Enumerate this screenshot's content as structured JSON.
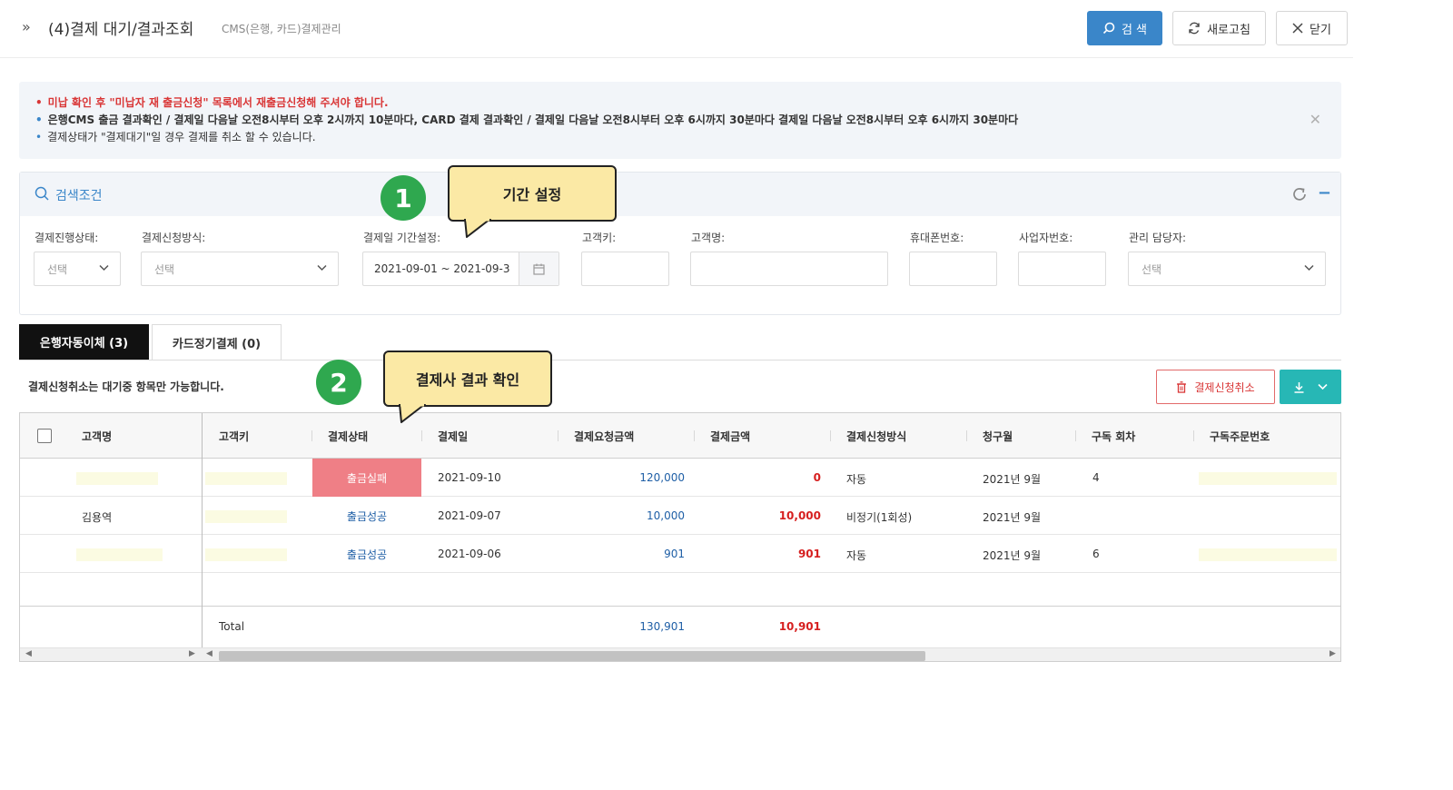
{
  "header": {
    "title": "(4)결제 대기/결과조회",
    "subtitle": "CMS(은행, 카드)결제관리",
    "search_label": "검 색",
    "refresh_label": "새로고침",
    "close_label": "닫기"
  },
  "notice": {
    "line1": "미납 확인 후 \"미납자 재 출금신청\" 목록에서 재출금신청해 주셔야 합니다.",
    "line2": "은행CMS 출금 결과확인 / 결제일 다음날 오전8시부터 오후 2시까지 10분마다, CARD 결제 결과확인 / 결제일 다음날 오전8시부터 오후 6시까지 30분마다 결제일 다음날 오전8시부터 오후 6시까지 30분마다",
    "line3": "결제상태가 \"결제대기\"일 경우 결제를 취소 할 수 있습니다."
  },
  "search_panel": {
    "title": "검색조건",
    "fields": {
      "status_label": "결제진행상태:",
      "status_value": "선택",
      "method_label": "결제신청방식:",
      "method_value": "선택",
      "period_label": "결제일 기간설정:",
      "period_value": "2021-09-01 ~ 2021-09-3",
      "customer_key_label": "고객키:",
      "customer_name_label": "고객명:",
      "phone_label": "휴대폰번호:",
      "biz_no_label": "사업자번호:",
      "manager_label": "관리 담당자:",
      "manager_value": "선택"
    }
  },
  "tabs": [
    {
      "label": "은행자동이체 (3)",
      "active": true
    },
    {
      "label": "카드정기결제 (0)",
      "active": false
    }
  ],
  "toolbar": {
    "note": "결제신청취소는 대기중 항목만 가능합니다.",
    "cancel_label": "결제신청취소"
  },
  "table": {
    "columns": [
      "고객명",
      "고객키",
      "결제상태",
      "결제일",
      "결제요청금액",
      "결제금액",
      "결제신청방식",
      "청구월",
      "구독 회차",
      "구독주문번호"
    ],
    "rows": [
      {
        "name": "",
        "key": "",
        "status": "출금실패",
        "date": "2021-09-10",
        "request_amount": "120,000",
        "amount": "0",
        "method": "자동",
        "billing_month": "2021년 9월",
        "round": "4",
        "order_no": ""
      },
      {
        "name": "김용역",
        "key": "",
        "status": "출금성공",
        "date": "2021-09-07",
        "request_amount": "10,000",
        "amount": "10,000",
        "method": "비정기(1회성)",
        "billing_month": "2021년 9월",
        "round": "",
        "order_no": ""
      },
      {
        "name": "",
        "key": "",
        "status": "출금성공",
        "date": "2021-09-06",
        "request_amount": "901",
        "amount": "901",
        "method": "자동",
        "billing_month": "2021년 9월",
        "round": "6",
        "order_no": ""
      }
    ],
    "total": {
      "label": "Total",
      "request_amount": "130,901",
      "amount": "10,901"
    }
  },
  "callouts": [
    {
      "number": "1",
      "text": "기간 설정"
    },
    {
      "number": "2",
      "text": "결제사 결과 확인"
    }
  ],
  "colors": {
    "primary": "#3a86c9",
    "fail_cell": "#ef7f86",
    "download": "#27b7b5",
    "badge": "#2fa84f",
    "callout": "#fbe9a5"
  }
}
